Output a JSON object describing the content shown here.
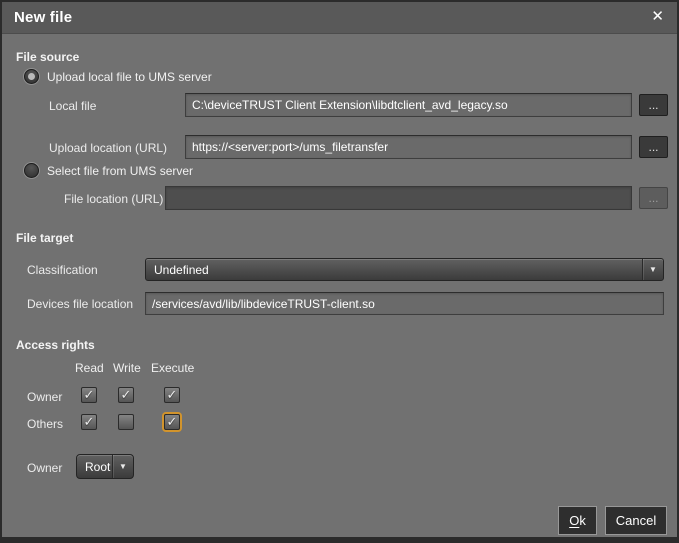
{
  "window": {
    "title": "New file"
  },
  "icons": {
    "close_glyph": "✕",
    "dropdown_arrow_glyph": "▼",
    "check_glyph": "✓",
    "browse_label": "..."
  },
  "colors": {
    "dialog_background": "#717171",
    "titlebar_background": "#595959",
    "field_background": "#6a6a6a",
    "disabled_field_background": "#4e4e4e",
    "button_background": "#2e2e2e",
    "focus_ring": "#d2942c"
  },
  "file_source": {
    "header": "File source",
    "radio_upload": {
      "label": "Upload local file to UMS server",
      "selected": true
    },
    "local_file": {
      "label": "Local file",
      "value": "C:\\deviceTRUST Client Extension\\libdtclient_avd_legacy.so"
    },
    "upload_location": {
      "label": "Upload location (URL)",
      "value": "https://<server:port>/ums_filetransfer"
    },
    "radio_select": {
      "label": "Select file from UMS server",
      "selected": false
    },
    "file_location": {
      "label": "File location (URL)",
      "value": "",
      "disabled": true
    }
  },
  "file_target": {
    "header": "File target",
    "classification": {
      "label": "Classification",
      "value": "Undefined"
    },
    "devices_file_location": {
      "label": "Devices file location",
      "value": "/services/avd/lib/libdeviceTRUST-client.so"
    }
  },
  "access_rights": {
    "header": "Access rights",
    "columns": [
      "Read",
      "Write",
      "Execute"
    ],
    "rows": {
      "owner": {
        "label": "Owner",
        "read": true,
        "write": true,
        "execute": true
      },
      "others": {
        "label": "Others",
        "read": true,
        "write": false,
        "execute": true
      }
    },
    "focused_checkbox": "others-execute",
    "owner_select": {
      "label": "Owner",
      "value": "Root"
    }
  },
  "footer": {
    "ok_label": "Ok",
    "cancel_label": "Cancel"
  }
}
